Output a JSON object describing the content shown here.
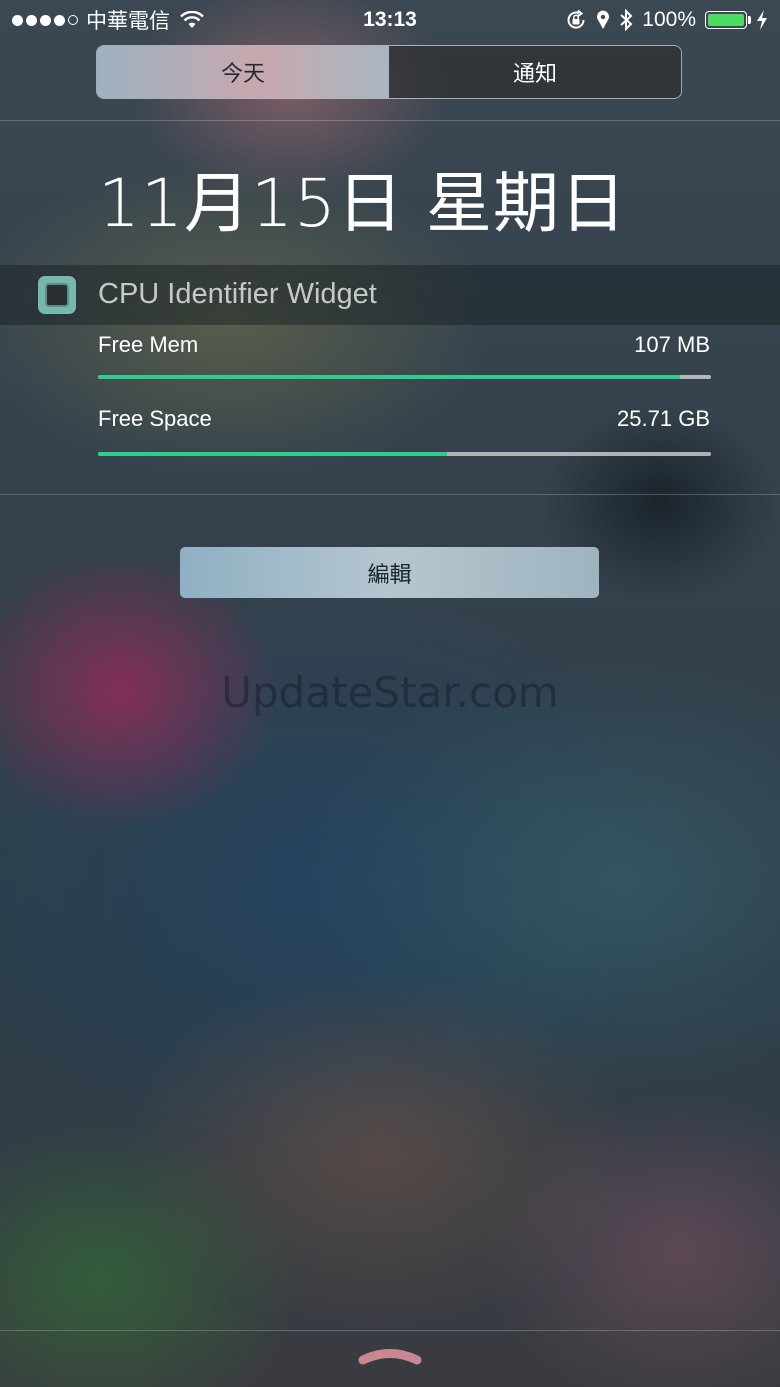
{
  "status_bar": {
    "carrier": "中華電信",
    "time": "13:13",
    "battery_percent": "100%",
    "battery_level": 1.0,
    "signal_bars": 4,
    "signal_total": 5,
    "icons": [
      "wifi-icon",
      "orientation-lock-icon",
      "location-icon",
      "bluetooth-icon",
      "battery-icon",
      "charging-bolt-icon"
    ],
    "battery_color": "#4cd964"
  },
  "segmented": {
    "today": "今天",
    "notifications": "通知",
    "selected": "today"
  },
  "date_heading": "11月15日 星期日",
  "widget": {
    "title": "CPU Identifier Widget",
    "icon": "cpu-chip-icon",
    "icon_color": "#76b8ac",
    "metrics": [
      {
        "label": "Free Mem",
        "value": "107 MB",
        "fill": 0.95
      },
      {
        "label": "Free Space",
        "value": "25.71 GB",
        "fill": 0.57
      }
    ],
    "bar_color": "#2ecc8f"
  },
  "edit_button": "編輯",
  "watermark": "UpdateStar.com",
  "grabber_icon": "chevron-up-grabber-icon"
}
